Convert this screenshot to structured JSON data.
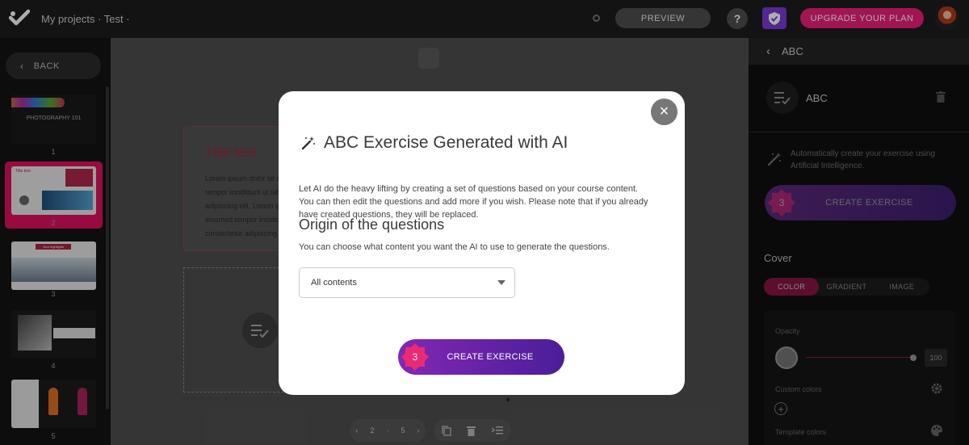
{
  "topbar": {
    "breadcrumb": "My projects · Test ·",
    "preview_label": "PREVIEW",
    "help_label": "?",
    "upgrade_label": "UPGRADE YOUR PLAN"
  },
  "sidebar": {
    "back_label": "BACK",
    "thumbnails": [
      {
        "number": "1",
        "caption": "PHOTOGRAPHY 101"
      },
      {
        "number": "2",
        "caption": "Title text"
      },
      {
        "number": "3",
        "caption": "Your highlights"
      },
      {
        "number": "4",
        "caption": ""
      },
      {
        "number": "5",
        "caption": ""
      }
    ]
  },
  "canvas": {
    "card_title": "Title text",
    "card_body": "Lorem ipsum dolor sit amet, tempor incididunt ut labore adipiscing elit. Lorem ipsum eiusmod tempor incididunt consectetur adipiscing elit",
    "pager": {
      "current": "2",
      "separator": "·",
      "total": "5"
    }
  },
  "right_panel": {
    "header": "ABC",
    "exercise_name": "ABC",
    "ai_description": "Automatically create your exercise using Artificial Intelligence.",
    "create_count": "3",
    "create_label": "CREATE EXERCISE",
    "cover_heading": "Cover",
    "tabs": [
      "COLOR",
      "GRADIENT",
      "IMAGE"
    ],
    "active_tab": "COLOR",
    "opacity_label": "Opacity",
    "opacity_value": "100",
    "custom_colors_label": "Custom colors",
    "template_colors_label": "Template colors"
  },
  "modal": {
    "title": "ABC Exercise Generated with AI",
    "description": "Let AI do the heavy lifting by creating a set of questions based on your course content. You can then edit the questions and add more if you wish. Please note that if you already have created questions, they will be replaced.",
    "origin_heading": "Origin of the questions",
    "origin_description": "You can choose what content you want the AI to use to generate the questions.",
    "select_value": "All contents",
    "create_count": "3",
    "create_label": "CREATE EXERCISE"
  },
  "colors": {
    "accent_pink": "#ed1f7b",
    "purple": "#7a3bd8",
    "create_gradient_start": "#8327b4",
    "create_gradient_end": "#4a1e9a"
  }
}
